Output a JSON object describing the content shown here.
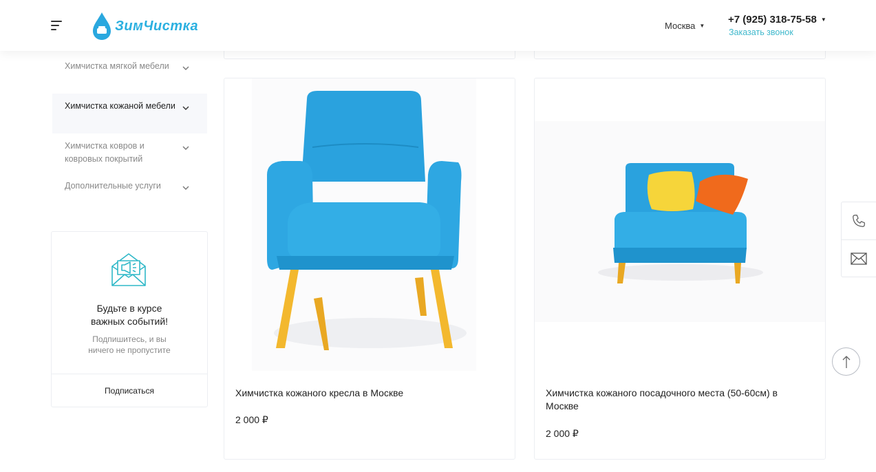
{
  "header": {
    "logo_text": "ЗимЧистка",
    "city": "Москва",
    "phone": "+7 (925) 318-75-58",
    "callback": "Заказать звонок"
  },
  "sidebar": {
    "items": [
      {
        "label": "Химчистка мягкой мебели",
        "active": false
      },
      {
        "label": "Химчистка кожаной мебели",
        "active": true
      },
      {
        "label": "Химчистка ковров и ковровых покрытий",
        "active": false
      },
      {
        "label": "Дополнительные услуги",
        "active": false
      }
    ]
  },
  "subscribe": {
    "title_line1": "Будьте в курсе",
    "title_line2": "важных событий!",
    "text_line1": "Подпишитесь, и вы",
    "text_line2": "ничего не пропустите",
    "button": "Подписаться"
  },
  "products": [
    {
      "name": "Химчистка кожаного кресла в Москве",
      "price": "2 000 ₽"
    },
    {
      "name": "Химчистка кожаного посадочного места (50-60см) в Москве",
      "price": "2 000 ₽"
    }
  ],
  "colors": {
    "accent": "#3fb8cc",
    "logo": "#2bb0e0",
    "chair": "#29a3df",
    "legs": "#f0b52a",
    "pillow_yellow": "#f6d53a",
    "pillow_orange": "#f06a1c"
  },
  "icons": [
    "menu-icon",
    "logo-drop-icon",
    "chevron-down-icon",
    "envelope-megaphone-icon",
    "phone-icon",
    "mail-icon",
    "arrow-up-icon"
  ]
}
